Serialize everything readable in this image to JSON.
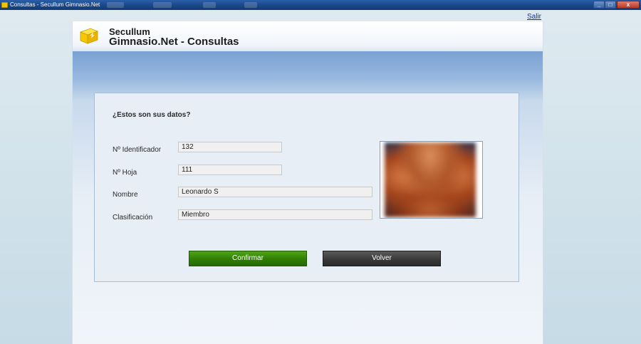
{
  "window": {
    "title": "Consultas - Secullum Gimnasio.Net",
    "buttons": {
      "minimize": "_",
      "maximize": "□",
      "close": "x"
    }
  },
  "header": {
    "logout_link": "Salir",
    "brand": "Secullum",
    "app_title": "Gimnasio.Net - Consultas"
  },
  "form": {
    "question": "¿Estos son sus datos?",
    "fields": [
      {
        "label": "Nº Identificador",
        "value": "132"
      },
      {
        "label": "Nº Hoja",
        "value": "111"
      },
      {
        "label": "Nombre",
        "value": "Leonardo S"
      },
      {
        "label": "Clasificación",
        "value": "Miembro"
      }
    ],
    "confirm_label": "Confirmar",
    "back_label": "Volver"
  },
  "colors": {
    "confirm": "#2f7d05",
    "back": "#3a3a3a",
    "link": "#1a2ea8",
    "titlebar": "#1c4a8c"
  },
  "icons": {
    "app": "folder-icon",
    "logo": "secullum-cube-logo"
  }
}
